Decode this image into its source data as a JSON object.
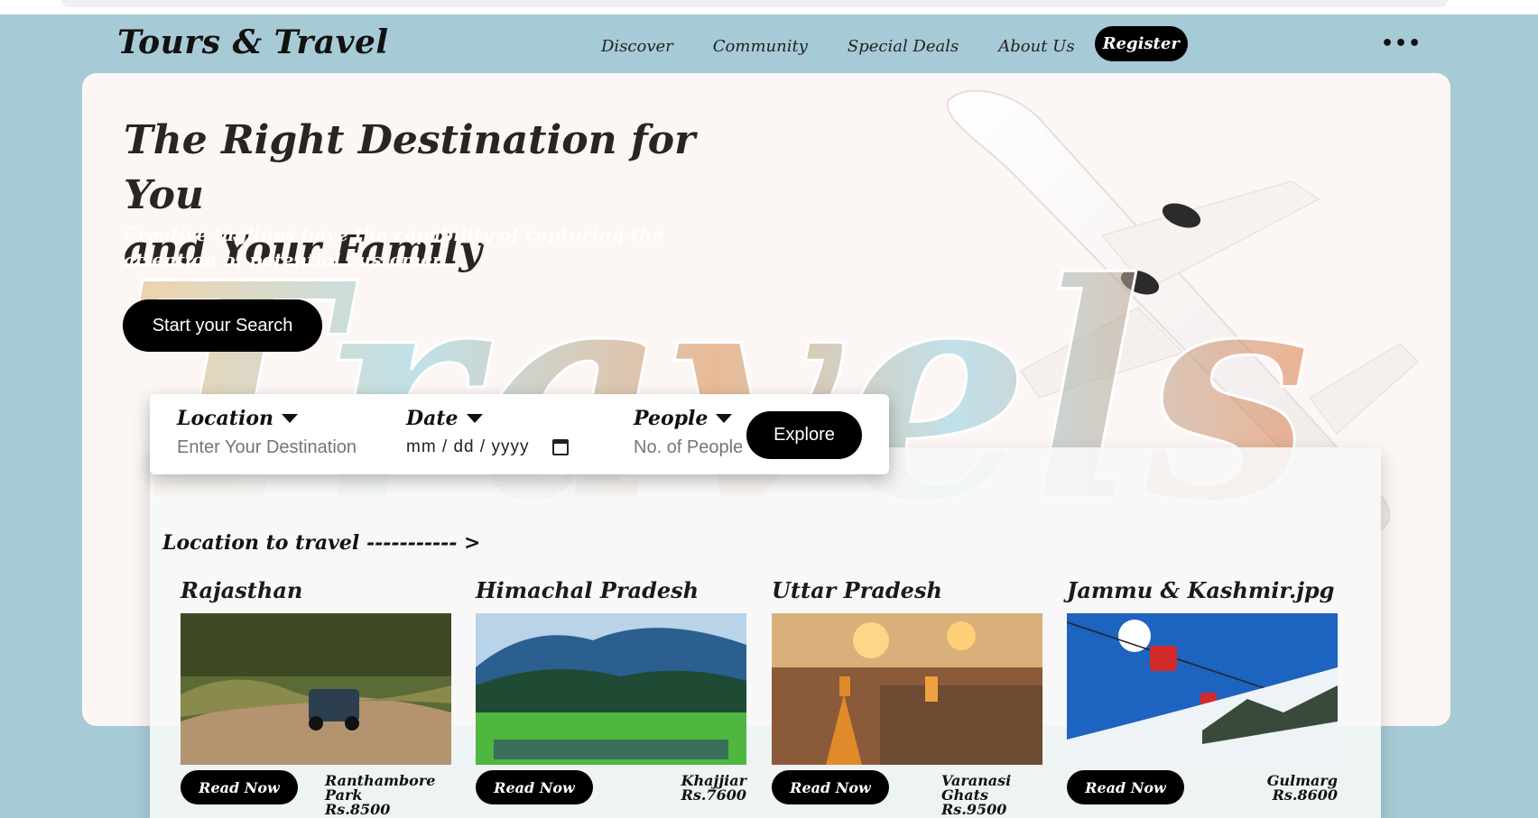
{
  "brand": "Tours & Travel",
  "nav": {
    "items": [
      "Discover",
      "Community",
      "Special Deals",
      "About Us"
    ],
    "register": "Register",
    "more": "•••"
  },
  "hero": {
    "headline_line1": "The Right Destination for You",
    "headline_line2": "and Your Family",
    "tagline": "Creative taglines have the capability of capturing the attention of potential customer.",
    "cta": "Start your Search",
    "script_word": "Travels"
  },
  "search": {
    "location_label": "Location",
    "location_placeholder": "Enter Your Destination",
    "date_label": "Date",
    "date_value": "mm / dd / yyyy",
    "people_label": "People",
    "people_placeholder": "No. of People",
    "explore": "Explore"
  },
  "locations": {
    "heading": "Location to travel ----------- >",
    "cards": [
      {
        "title": "Rajasthan",
        "button": "Read Now",
        "place": "Ranthambore Park",
        "price": "Rs.8500"
      },
      {
        "title": "Himachal Pradesh",
        "button": "Read Now",
        "place": "Khajjiar",
        "price": "Rs.7600"
      },
      {
        "title": "Uttar Pradesh",
        "button": "Read Now",
        "place": "Varanasi Ghats",
        "price": "Rs.9500"
      },
      {
        "title": "Jammu & Kashmir.jpg",
        "button": "Read Now",
        "place": "Gulmarg",
        "price": "Rs.8600"
      }
    ]
  },
  "colors": {
    "page_bg": "#a7cbd6",
    "hero_bg": "#fcf6f4",
    "button": "#000000"
  }
}
